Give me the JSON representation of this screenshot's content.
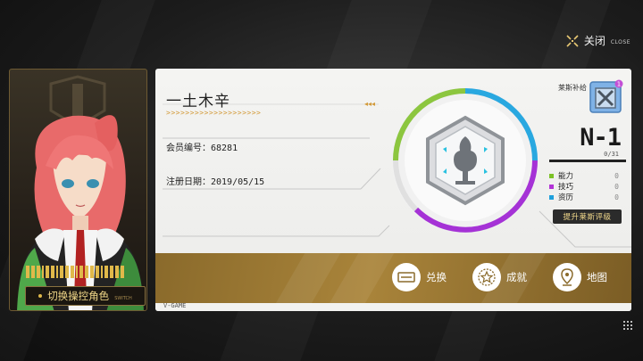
{
  "close": {
    "label": "关闭",
    "sublabel": "CLOSE",
    "icon": "close-cross-icon"
  },
  "character_panel": {
    "switch_label": "切换操控角色",
    "switch_sublabel": "SWITCH",
    "portrait": "pink-haired-character-portrait"
  },
  "profile": {
    "name": "一土木辛",
    "chevrons": ">>>>>>>>>>>>>>>>>>>>",
    "chevrons_small": "◂◂◂",
    "member_id_label": "会员编号：",
    "member_id": "68281",
    "register_label": "注册日期：",
    "register_date": "2019/05/15"
  },
  "rank": {
    "label": "莱斯补给",
    "badge_count": "1",
    "value": "N-1",
    "progress_text": "0/31",
    "stats": [
      {
        "label": "能力",
        "value": "0",
        "color": "#7cc226"
      },
      {
        "label": "技巧",
        "value": "0",
        "color": "#b233d6"
      },
      {
        "label": "资历",
        "value": "0",
        "color": "#1fa0dc"
      }
    ],
    "upgrade_label": "提升莱斯评级"
  },
  "ring_colors": {
    "green": "#8cc63f",
    "blue": "#29a8e0",
    "purple": "#a532d6"
  },
  "actions": [
    {
      "label": "兑换",
      "icon": "ticket-icon"
    },
    {
      "label": "成就",
      "icon": "star-medal-icon"
    },
    {
      "label": "地图",
      "icon": "map-pin-icon"
    }
  ],
  "footer": {
    "label": "V-GAME"
  }
}
